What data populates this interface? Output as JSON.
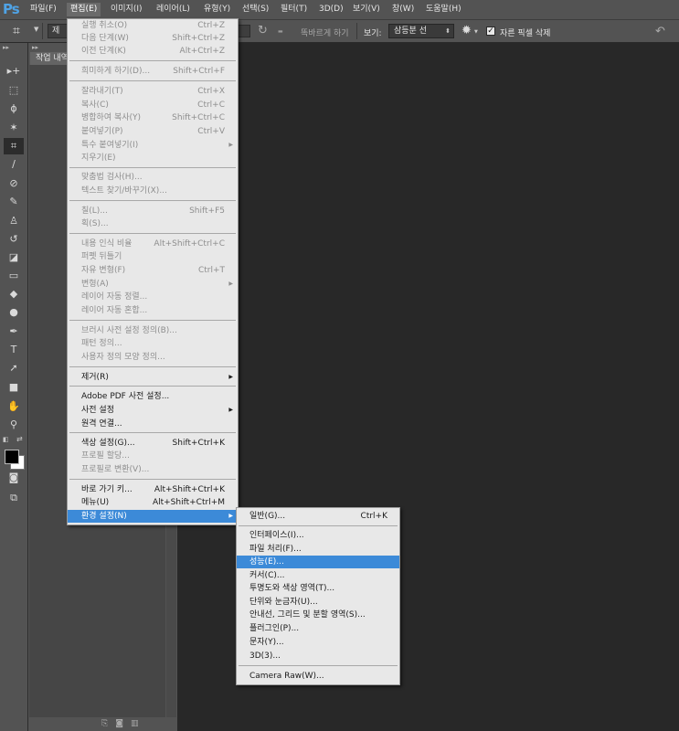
{
  "app": {
    "logo": "Ps"
  },
  "menubar": {
    "items": [
      {
        "label": "파일(F)"
      },
      {
        "label": "편집(E)"
      },
      {
        "label": "이미지(I)"
      },
      {
        "label": "레이어(L)"
      },
      {
        "label": "유형(Y)"
      },
      {
        "label": "선택(S)"
      },
      {
        "label": "필터(T)"
      },
      {
        "label": "3D(D)"
      },
      {
        "label": "보기(V)"
      },
      {
        "label": "창(W)"
      },
      {
        "label": "도움말(H)"
      }
    ]
  },
  "options": {
    "tool_icon": "crop-icon",
    "ratio_value": "제한",
    "straighten_label": "똑바르게 하기",
    "view_label": "보기:",
    "view_value": "삼등분 선",
    "delete_cropped_label": "자른 픽셀 삭제",
    "delete_cropped_checked": true
  },
  "history_panel": {
    "tab": "작업 내역"
  },
  "edit_menu": {
    "items": [
      {
        "label": "실행 취소(O)",
        "shortcut": "Ctrl+Z",
        "enabled": false
      },
      {
        "label": "다음 단계(W)",
        "shortcut": "Shift+Ctrl+Z",
        "enabled": false
      },
      {
        "label": "이전 단계(K)",
        "shortcut": "Alt+Ctrl+Z",
        "enabled": false
      },
      {
        "label": "희미하게 하기(D)...",
        "shortcut": "Shift+Ctrl+F",
        "enabled": false
      },
      {
        "label": "잘라내기(T)",
        "shortcut": "Ctrl+X",
        "enabled": false
      },
      {
        "label": "복사(C)",
        "shortcut": "Ctrl+C",
        "enabled": false
      },
      {
        "label": "병합하여 복사(Y)",
        "shortcut": "Shift+Ctrl+C",
        "enabled": false
      },
      {
        "label": "붙여넣기(P)",
        "shortcut": "Ctrl+V",
        "enabled": false
      },
      {
        "label": "특수 붙여넣기(I)",
        "shortcut": "",
        "enabled": false,
        "submenu": true
      },
      {
        "label": "지우기(E)",
        "shortcut": "",
        "enabled": false
      },
      {
        "label": "맞춤법 검사(H)...",
        "shortcut": "",
        "enabled": false
      },
      {
        "label": "텍스트 찾기/바꾸기(X)...",
        "shortcut": "",
        "enabled": false
      },
      {
        "label": "칠(L)...",
        "shortcut": "Shift+F5",
        "enabled": false
      },
      {
        "label": "획(S)...",
        "shortcut": "",
        "enabled": false
      },
      {
        "label": "내용 인식 비율",
        "shortcut": "Alt+Shift+Ctrl+C",
        "enabled": false
      },
      {
        "label": "퍼펫 뒤틀기",
        "shortcut": "",
        "enabled": false
      },
      {
        "label": "자유 변형(F)",
        "shortcut": "Ctrl+T",
        "enabled": false
      },
      {
        "label": "변형(A)",
        "shortcut": "",
        "enabled": false,
        "submenu": true
      },
      {
        "label": "레이어 자동 정렬...",
        "shortcut": "",
        "enabled": false
      },
      {
        "label": "레이어 자동 혼합...",
        "shortcut": "",
        "enabled": false
      },
      {
        "label": "브러시 사전 설정 정의(B)...",
        "shortcut": "",
        "enabled": false
      },
      {
        "label": "패턴 정의...",
        "shortcut": "",
        "enabled": false
      },
      {
        "label": "사용자 정의 모양 정의...",
        "shortcut": "",
        "enabled": false
      },
      {
        "label": "제거(R)",
        "shortcut": "",
        "enabled": true,
        "submenu": true
      },
      {
        "label": "Adobe PDF 사전 설정...",
        "shortcut": "",
        "enabled": true
      },
      {
        "label": "사전 설정",
        "shortcut": "",
        "enabled": true,
        "submenu": true
      },
      {
        "label": "원격 연결...",
        "shortcut": "",
        "enabled": true
      },
      {
        "label": "색상 설정(G)...",
        "shortcut": "Shift+Ctrl+K",
        "enabled": true
      },
      {
        "label": "프로필 할당...",
        "shortcut": "",
        "enabled": false
      },
      {
        "label": "프로필로 변환(V)...",
        "shortcut": "",
        "enabled": false
      },
      {
        "label": "바로 가기 키...",
        "shortcut": "Alt+Shift+Ctrl+K",
        "enabled": true
      },
      {
        "label": "메뉴(U)",
        "shortcut": "Alt+Shift+Ctrl+M",
        "enabled": true
      },
      {
        "label": "환경 설정(N)",
        "shortcut": "",
        "enabled": true,
        "submenu": true,
        "highlighted": true
      }
    ]
  },
  "prefs_submenu": {
    "items": [
      {
        "label": "일반(G)...",
        "shortcut": "Ctrl+K"
      },
      {
        "label": "인터페이스(I)...",
        "shortcut": ""
      },
      {
        "label": "파일 처리(F)...",
        "shortcut": ""
      },
      {
        "label": "성능(E)...",
        "shortcut": "",
        "highlighted": true
      },
      {
        "label": "커서(C)...",
        "shortcut": ""
      },
      {
        "label": "투명도와 색상 영역(T)...",
        "shortcut": ""
      },
      {
        "label": "단위와 눈금자(U)...",
        "shortcut": ""
      },
      {
        "label": "안내선, 그리드 및 분할 영역(S)...",
        "shortcut": ""
      },
      {
        "label": "플러그인(P)...",
        "shortcut": ""
      },
      {
        "label": "문자(Y)...",
        "shortcut": ""
      },
      {
        "label": "3D(3)...",
        "shortcut": ""
      },
      {
        "label": "Camera Raw(W)...",
        "shortcut": ""
      }
    ]
  },
  "colors": {
    "highlight": "#3c8ad8",
    "menu_bg": "#e8e8e8",
    "panel_bg": "#535353",
    "canvas_bg": "#282828",
    "logo": "#4fa3e6"
  }
}
